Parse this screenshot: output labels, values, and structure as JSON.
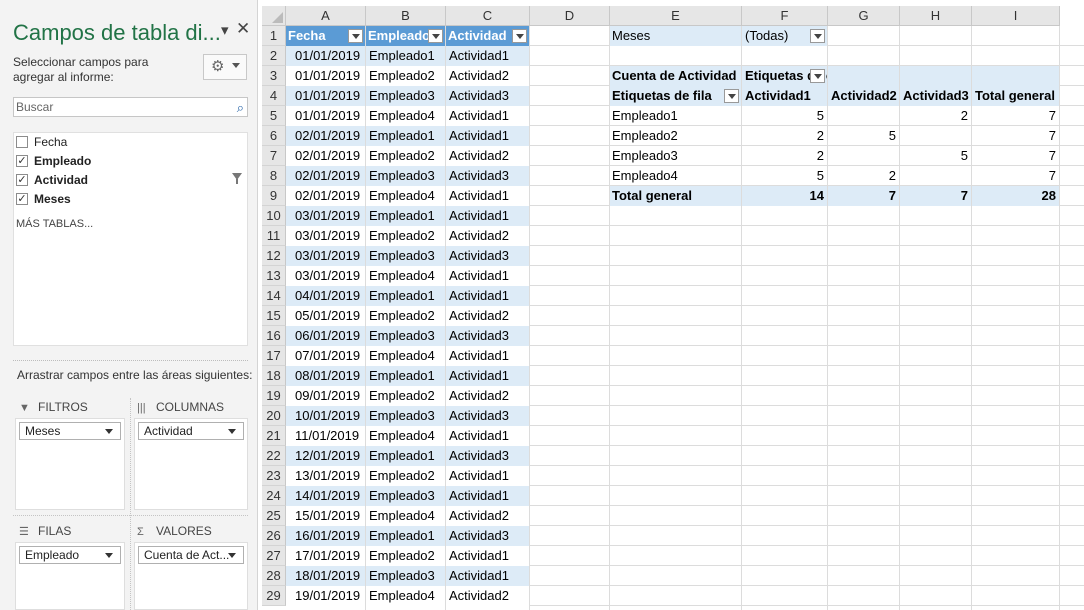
{
  "panel": {
    "title": "Campos de tabla di...",
    "subtitle": "Seleccionar campos para agregar al informe:",
    "search_placeholder": "Buscar",
    "fields": [
      {
        "label": "Fecha",
        "checked": false,
        "bold": false,
        "check_glyph": ""
      },
      {
        "label": "Empleado",
        "checked": true,
        "bold": true,
        "check_glyph": "✓"
      },
      {
        "label": "Actividad",
        "checked": true,
        "bold": true,
        "check_glyph": "✓"
      },
      {
        "label": "Meses",
        "checked": true,
        "bold": true,
        "check_glyph": "✓"
      }
    ],
    "more_tables": "MÁS TABLAS...",
    "drag_text": "Arrastrar campos entre las áreas siguientes:",
    "areas": {
      "filters": {
        "label": "FILTROS",
        "item": "Meses",
        "icon": "filter-icon"
      },
      "columns": {
        "label": "COLUMNAS",
        "item": "Actividad",
        "icon": "columns-icon"
      },
      "rows": {
        "label": "FILAS",
        "item": "Empleado",
        "icon": "rows-icon"
      },
      "values": {
        "label": "VALORES",
        "item": "Cuenta de Act...",
        "icon": "sigma-icon"
      }
    }
  },
  "sheet": {
    "columns": [
      "A",
      "B",
      "C",
      "D",
      "E",
      "F",
      "G",
      "H",
      "I"
    ],
    "rows": [
      "1",
      "2",
      "3",
      "4",
      "5",
      "6",
      "7",
      "8",
      "9",
      "10",
      "11",
      "12",
      "13",
      "14",
      "15",
      "16",
      "17",
      "18",
      "19",
      "20",
      "21",
      "22",
      "23",
      "24",
      "25",
      "26",
      "27",
      "28",
      "29"
    ],
    "table": {
      "headers": [
        "Fecha",
        "Empleado",
        "Actividad"
      ],
      "data": [
        [
          "01/01/2019",
          "Empleado1",
          "Actividad1"
        ],
        [
          "01/01/2019",
          "Empleado2",
          "Actividad2"
        ],
        [
          "01/01/2019",
          "Empleado3",
          "Actividad3"
        ],
        [
          "01/01/2019",
          "Empleado4",
          "Actividad1"
        ],
        [
          "02/01/2019",
          "Empleado1",
          "Actividad1"
        ],
        [
          "02/01/2019",
          "Empleado2",
          "Actividad2"
        ],
        [
          "02/01/2019",
          "Empleado3",
          "Actividad3"
        ],
        [
          "02/01/2019",
          "Empleado4",
          "Actividad1"
        ],
        [
          "03/01/2019",
          "Empleado1",
          "Actividad1"
        ],
        [
          "03/01/2019",
          "Empleado2",
          "Actividad2"
        ],
        [
          "03/01/2019",
          "Empleado3",
          "Actividad3"
        ],
        [
          "03/01/2019",
          "Empleado4",
          "Actividad1"
        ],
        [
          "04/01/2019",
          "Empleado1",
          "Actividad1"
        ],
        [
          "05/01/2019",
          "Empleado2",
          "Actividad2"
        ],
        [
          "06/01/2019",
          "Empleado3",
          "Actividad3"
        ],
        [
          "07/01/2019",
          "Empleado4",
          "Actividad1"
        ],
        [
          "08/01/2019",
          "Empleado1",
          "Actividad1"
        ],
        [
          "09/01/2019",
          "Empleado2",
          "Actividad2"
        ],
        [
          "10/01/2019",
          "Empleado3",
          "Actividad3"
        ],
        [
          "11/01/2019",
          "Empleado4",
          "Actividad1"
        ],
        [
          "12/01/2019",
          "Empleado1",
          "Actividad3"
        ],
        [
          "13/01/2019",
          "Empleado2",
          "Actividad1"
        ],
        [
          "14/01/2019",
          "Empleado3",
          "Actividad1"
        ],
        [
          "15/01/2019",
          "Empleado4",
          "Actividad2"
        ],
        [
          "16/01/2019",
          "Empleado1",
          "Actividad3"
        ],
        [
          "17/01/2019",
          "Empleado2",
          "Actividad1"
        ],
        [
          "18/01/2019",
          "Empleado3",
          "Actividad1"
        ],
        [
          "19/01/2019",
          "Empleado4",
          "Actividad2"
        ]
      ]
    },
    "pivot": {
      "filter_label": "Meses",
      "filter_value": "(Todas)",
      "values_label": "Cuenta de Actividad",
      "col_labels": "Etiquetas de columna",
      "row_labels": "Etiquetas de fila",
      "col_headers": [
        "Actividad1",
        "Actividad2",
        "Actividad3",
        "Total general"
      ],
      "rows": [
        {
          "label": "Empleado1",
          "values": [
            "5",
            "",
            "2",
            "7"
          ]
        },
        {
          "label": "Empleado2",
          "values": [
            "2",
            "5",
            "",
            "7"
          ]
        },
        {
          "label": "Empleado3",
          "values": [
            "2",
            "",
            "5",
            "7"
          ]
        },
        {
          "label": "Empleado4",
          "values": [
            "5",
            "2",
            "",
            "7"
          ]
        }
      ],
      "total": {
        "label": "Total general",
        "values": [
          "14",
          "7",
          "7",
          "28"
        ]
      }
    }
  },
  "colors": {
    "accent": "#217346",
    "table_header": "#5b9bd5",
    "band": "#ddebf7"
  }
}
